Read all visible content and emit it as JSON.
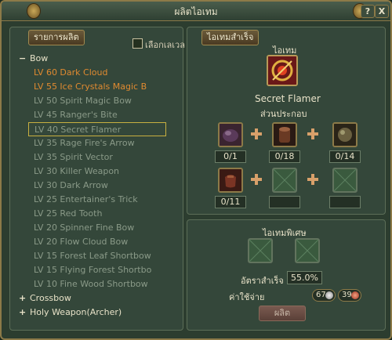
{
  "window": {
    "title": "ผลิตไอเทม",
    "help_label": "?",
    "close_label": "X"
  },
  "left_panel": {
    "tab_label": "รายการผลิต",
    "level_checkbox_label": "เลือกเลเวล",
    "tree": [
      {
        "type": "category",
        "sign": "−",
        "label": "Bow"
      },
      {
        "type": "item",
        "label": "LV 60 Dark Cloud",
        "style": "orange"
      },
      {
        "type": "item",
        "label": "LV 55 Ice Crystals Magic B",
        "style": "orange"
      },
      {
        "type": "item",
        "label": "LV 50 Spirit Magic Bow",
        "style": "gray"
      },
      {
        "type": "item",
        "label": "LV 45 Ranger's Bite",
        "style": "gray"
      },
      {
        "type": "item",
        "label": "LV 40 Secret Flamer",
        "style": "selected"
      },
      {
        "type": "item",
        "label": "LV 35 Rage Fire's Arrow",
        "style": "gray"
      },
      {
        "type": "item",
        "label": "LV 35 Spirit Vector",
        "style": "gray"
      },
      {
        "type": "item",
        "label": "LV 30 Killer Weapon",
        "style": "gray"
      },
      {
        "type": "item",
        "label": "LV 30 Dark Arrow",
        "style": "gray"
      },
      {
        "type": "item",
        "label": "LV 25 Entertainer's Trick",
        "style": "gray"
      },
      {
        "type": "item",
        "label": "LV 25 Red Tooth",
        "style": "gray"
      },
      {
        "type": "item",
        "label": "LV 20 Spinner Fine Bow",
        "style": "gray"
      },
      {
        "type": "item",
        "label": "LV 20 Flow Cloud Bow",
        "style": "gray"
      },
      {
        "type": "item",
        "label": "LV 15 Forest Leaf Shortbow",
        "style": "gray"
      },
      {
        "type": "item",
        "label": "LV 15 Flying Forest Shortbo",
        "style": "gray"
      },
      {
        "type": "item",
        "label": "LV 10 Fine Wood Shortbow",
        "style": "gray"
      },
      {
        "type": "category",
        "sign": "+",
        "label": "Crossbow"
      },
      {
        "type": "category",
        "sign": "+",
        "label": "Holy Weapon(Archer)"
      }
    ]
  },
  "result_panel": {
    "tab_label": "ไอเทมสำเร็จ",
    "item_heading": "ไอเทม",
    "item_name": "Secret Flamer",
    "item_icon": "flamer-bow-icon",
    "components_heading": "ส่วนประกอบ",
    "materials": [
      {
        "icon": "dark-orb-icon",
        "count": "0/1"
      },
      {
        "icon": "wood-log-icon",
        "count": "0/18"
      },
      {
        "icon": "stone-ball-icon",
        "count": "0/14"
      },
      {
        "icon": "leather-pouch-icon",
        "count": "0/11"
      },
      {
        "icon": "empty-slot-icon",
        "count": ""
      },
      {
        "icon": "empty-slot-icon",
        "count": ""
      }
    ]
  },
  "special_panel": {
    "heading": "ไอเทมพิเศษ",
    "success_label": "อัตราสำเร็จ",
    "success_value": "55.0%",
    "cost_label": "ค่าใช้จ่าย",
    "cost_silver": "67",
    "cost_copper": "39",
    "make_button_label": "ผลิต"
  },
  "colors": {
    "frame": "#8c7a48",
    "panel": "#34473a",
    "orange_item": "#e08a30",
    "gray_item": "#8a9a88",
    "selected_border": "#c8b040"
  }
}
